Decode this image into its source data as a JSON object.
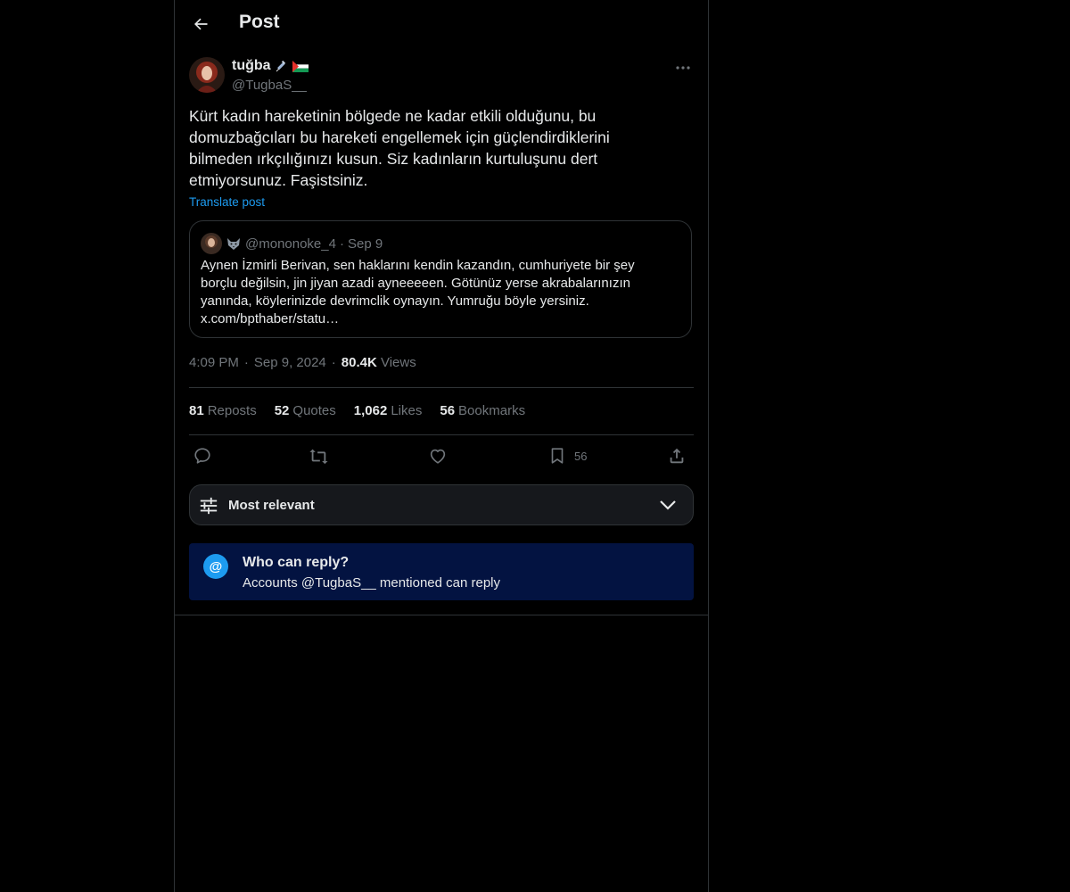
{
  "header": {
    "title": "Post"
  },
  "author": {
    "name": "tuğba",
    "handle": "@TugbaS__"
  },
  "post": {
    "text": "Kürt kadın hareketinin bölgede ne kadar etkili olduğunu, bu domuzbağcıları bu hareketi engellemek için güçlendirdiklerini bilmeden ırkçılığınızı kusun. Siz kadınların kurtuluşunu dert etmiyorsunuz. Faşistsiniz.",
    "translate_label": "Translate post"
  },
  "quote": {
    "handle": "@mononoke_4",
    "sep": "·",
    "date": "Sep 9",
    "text": "Aynen İzmirli Berivan, sen haklarını kendin kazandın, cumhuriyete bir şey borçlu değilsin, jin jiyan azadi ayneeeeen. Götünüz yerse akrabalarınızın yanında, köylerinizde devrimclik oynayın. Yumruğu böyle yersiniz. x.com/bpthaber/statu…"
  },
  "meta": {
    "time": "4:09 PM",
    "sep": "·",
    "date": "Sep 9, 2024",
    "views_count": "80.4K",
    "views_label": "Views"
  },
  "stats": [
    {
      "count": "81",
      "label": "Reposts"
    },
    {
      "count": "52",
      "label": "Quotes"
    },
    {
      "count": "1,062",
      "label": "Likes"
    },
    {
      "count": "56",
      "label": "Bookmarks"
    }
  ],
  "actions": {
    "bookmark_count": "56"
  },
  "sort": {
    "label": "Most relevant"
  },
  "reply_restriction": {
    "title": "Who can reply?",
    "subtitle": "Accounts @TugbaS__ mentioned can reply"
  },
  "colors": {
    "accent": "#1d9bf0",
    "muted": "#71767b",
    "background": "#000000",
    "reply_box": "#031341"
  }
}
